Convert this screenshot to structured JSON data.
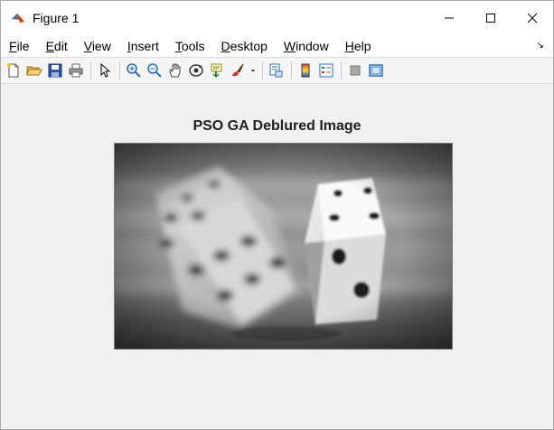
{
  "window": {
    "title": "Figure 1"
  },
  "menu": [
    "File",
    "Edit",
    "View",
    "Insert",
    "Tools",
    "Desktop",
    "Window",
    "Help"
  ],
  "menu_accel": [
    "F",
    "E",
    "V",
    "I",
    "T",
    "D",
    "W",
    "H"
  ],
  "menu_dock_icon": "dock-arrow-icon",
  "toolbar_icons": [
    "new-figure-icon",
    "open-file-icon",
    "save-icon",
    "print-icon",
    "pointer-icon",
    "zoom-in-icon",
    "zoom-out-icon",
    "pan-icon",
    "rotate-3d-icon",
    "data-cursor-icon",
    "brush-icon",
    "brush-dropdown-icon",
    "link-plot-icon",
    "colorbar-icon",
    "legend-icon",
    "hide-plot-tools-icon",
    "show-plot-tools-icon"
  ],
  "axes": {
    "title": "PSO GA Deblured Image"
  },
  "colors": {
    "titlebar": "#ffffff",
    "background": "#f0f0f0",
    "matlab_orange": "#e07020"
  }
}
